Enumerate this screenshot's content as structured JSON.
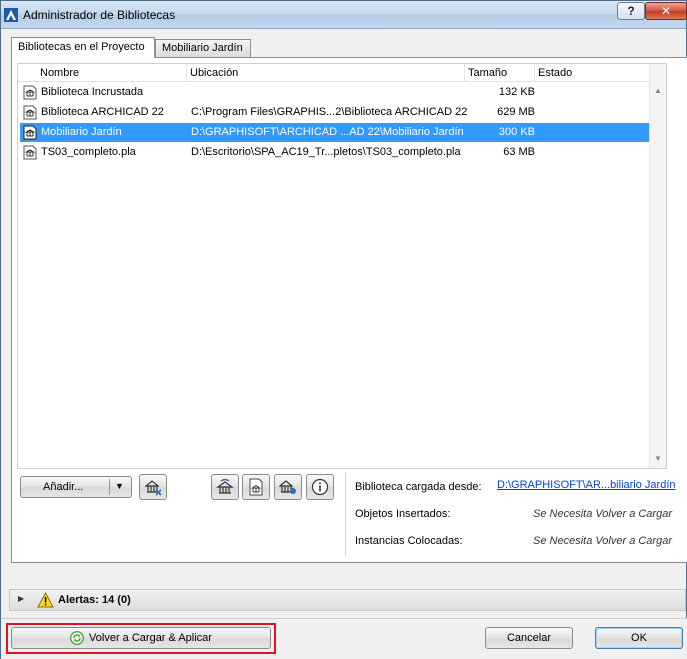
{
  "window": {
    "title": "Administrador de Bibliotecas",
    "help_label": "?",
    "close_label": "✕"
  },
  "tabs": [
    {
      "label": "Bibliotecas en el Proyecto",
      "active": true
    },
    {
      "label": "Mobiliario Jardín",
      "active": false
    }
  ],
  "table": {
    "columns": [
      "Nombre",
      "Ubicación",
      "Tamaño",
      "Estado"
    ],
    "rows": [
      {
        "name": "Biblioteca Incrustada",
        "location": "",
        "size": "132 KB",
        "status": "",
        "selected": false
      },
      {
        "name": "Biblioteca ARCHICAD 22",
        "location": "C:\\Program Files\\GRAPHIS...2\\Biblioteca ARCHICAD 22",
        "size": "629 MB",
        "status": "",
        "selected": false
      },
      {
        "name": "Mobiliario Jardín",
        "location": "D:\\GRAPHISOFT\\ARCHICAD ...AD 22\\Mobiliario Jardín",
        "size": "300 KB",
        "status": "",
        "selected": true
      },
      {
        "name": "TS03_completo.pla",
        "location": "D:\\Escritorio\\SPA_AC19_Tr...pletos\\TS03_completo.pla",
        "size": "63 MB",
        "status": "",
        "selected": false
      }
    ]
  },
  "toolbar": {
    "add_label": "Añadir...",
    "add_dropdown_icon": "chevron-down-icon"
  },
  "info": {
    "loaded_from_label": "Biblioteca cargada desde:",
    "loaded_from_value": "D:\\GRAPHISOFT\\AR...biliario Jardín",
    "inserted_label": "Objetos Insertados:",
    "inserted_value": "Se Necesita Volver a Cargar",
    "placed_label": "Instancias Colocadas:",
    "placed_value": "Se Necesita Volver a Cargar"
  },
  "alerts": {
    "label": "Alertas: 14 (0)"
  },
  "footer": {
    "reload_label": "Volver a Cargar & Aplicar",
    "cancel_label": "Cancelar",
    "ok_label": "OK"
  },
  "colors": {
    "selection": "#3399ff",
    "highlight_frame": "#e0141e",
    "link": "#0044cc"
  }
}
